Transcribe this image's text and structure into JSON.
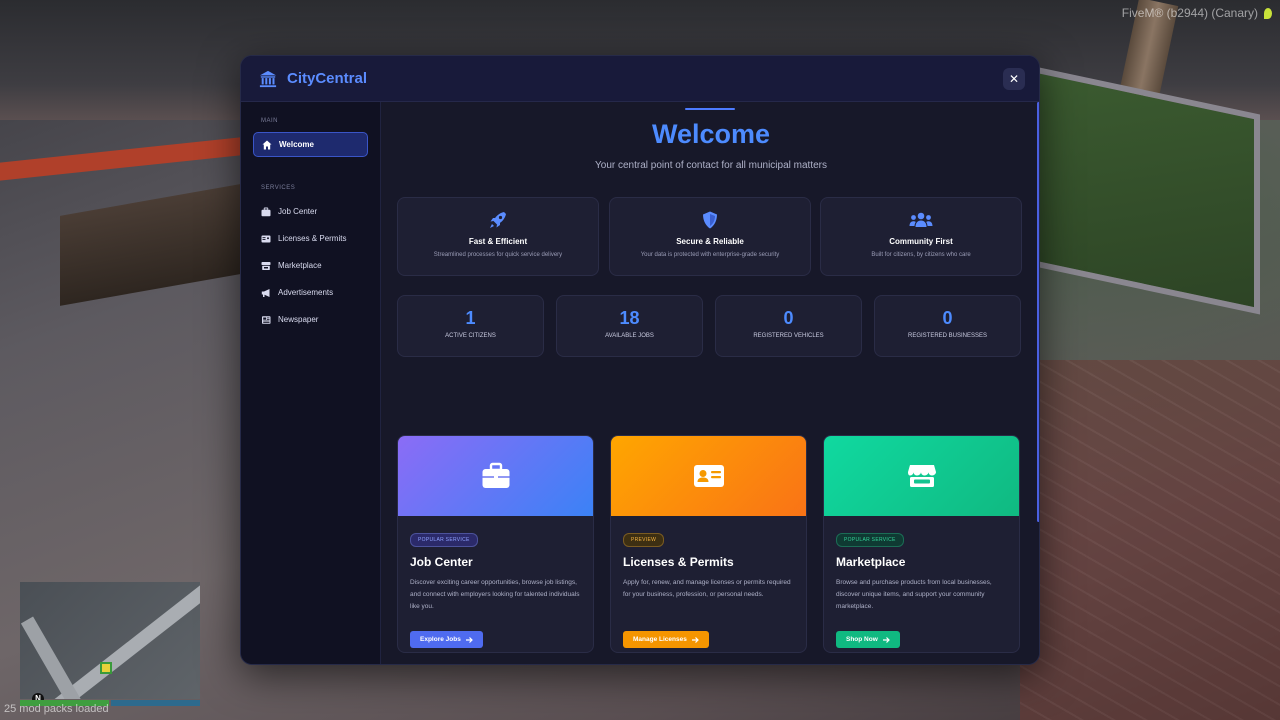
{
  "overlay": {
    "fivem_label": "FiveM® (b2944) (Canary)",
    "mods_loaded": "25 mod packs loaded",
    "minimap_north": "N"
  },
  "header": {
    "brand": "CityCentral",
    "close_label": "✕"
  },
  "sidebar": {
    "sections": [
      {
        "title": "MAIN",
        "items": [
          {
            "label": "Welcome",
            "icon": "home-icon",
            "active": true
          }
        ]
      },
      {
        "title": "SERVICES",
        "items": [
          {
            "label": "Job Center",
            "icon": "briefcase-icon"
          },
          {
            "label": "Licenses & Permits",
            "icon": "id-card-icon"
          },
          {
            "label": "Marketplace",
            "icon": "store-icon"
          },
          {
            "label": "Advertisements",
            "icon": "megaphone-icon"
          },
          {
            "label": "Newspaper",
            "icon": "newspaper-icon"
          }
        ]
      }
    ]
  },
  "welcome": {
    "title": "Welcome",
    "subtitle": "Your central point of contact for all municipal matters"
  },
  "features": [
    {
      "icon": "rocket-icon",
      "title": "Fast & Efficient",
      "desc": "Streamlined processes for quick service delivery"
    },
    {
      "icon": "shield-icon",
      "title": "Secure & Reliable",
      "desc": "Your data is protected with enterprise-grade security"
    },
    {
      "icon": "users-icon",
      "title": "Community First",
      "desc": "Built for citizens, by citizens who care"
    }
  ],
  "stats": [
    {
      "value": "1",
      "label": "ACTIVE CITIZENS"
    },
    {
      "value": "18",
      "label": "AVAILABLE JOBS"
    },
    {
      "value": "0",
      "label": "REGISTERED VEHICLES"
    },
    {
      "value": "0",
      "label": "REGISTERED BUSINESSES"
    }
  ],
  "cards": [
    {
      "icon": "briefcase-icon",
      "badge": "POPULAR SERVICE",
      "title": "Job Center",
      "desc": "Discover exciting career opportunities, browse job listings, and connect with employers looking for talented individuals like you.",
      "button": "Explore Jobs",
      "colors": {
        "from": "#8b6cf6",
        "to": "#3b82f6",
        "badge_bg": "#2b2a6a",
        "badge_fg": "#8fa2ff",
        "button": "#4f6bf0"
      }
    },
    {
      "icon": "id-card-icon",
      "badge": "PREVIEW",
      "title": "Licenses & Permits",
      "desc": "Apply for, renew, and manage licenses or permits required for your business, profession, or personal needs.",
      "button": "Manage Licenses",
      "colors": {
        "from": "#ffa600",
        "to": "#f97316",
        "badge_bg": "#3d2f12",
        "badge_fg": "#f5b340",
        "button": "#f59500"
      }
    },
    {
      "icon": "store-icon",
      "badge": "POPULAR SERVICE",
      "title": "Marketplace",
      "desc": "Browse and purchase products from local businesses, discover unique items, and support your community marketplace.",
      "button": "Shop Now",
      "colors": {
        "from": "#10d9a0",
        "to": "#10b981",
        "badge_bg": "#0f3a33",
        "badge_fg": "#34d399",
        "button": "#10b981"
      }
    },
    {
      "icon": "megaphone-icon",
      "colors": {
        "from": "#f43f9a",
        "to": "#ec4899"
      }
    },
    {
      "icon": "newspaper-icon",
      "colors": {
        "from": "#1ea7ff",
        "to": "#0ea5e9"
      }
    }
  ]
}
